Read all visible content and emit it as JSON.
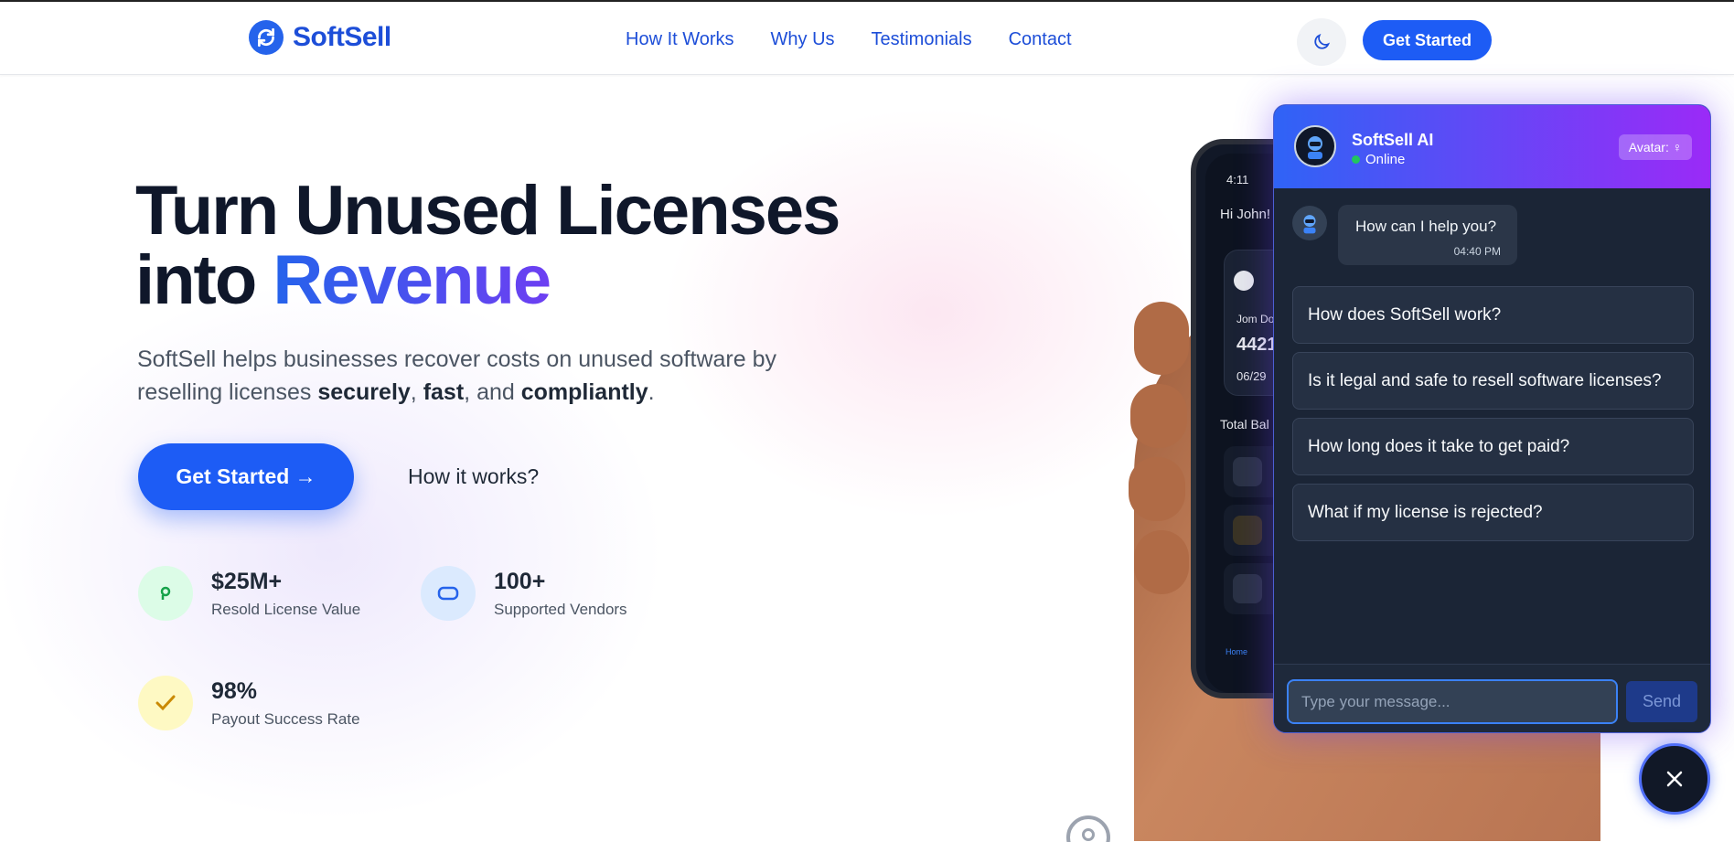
{
  "header": {
    "brand": "SoftSell",
    "nav": [
      "How It Works",
      "Why Us",
      "Testimonials",
      "Contact"
    ],
    "cta_label": "Get Started"
  },
  "hero": {
    "title_line1": "Turn Unused Licenses",
    "title_line2_prefix": "into ",
    "title_highlight": "Revenue",
    "subtitle_part1": "SoftSell helps businesses recover costs on unused software by reselling licenses ",
    "subtitle_bold1": "securely",
    "subtitle_sep1": ", ",
    "subtitle_bold2": "fast",
    "subtitle_sep2": ", and ",
    "subtitle_bold3": "compliantly",
    "subtitle_end": ".",
    "cta_label": "Get Started →",
    "secondary_label": "How it works?"
  },
  "stats": [
    {
      "value": "$25M+",
      "label": "Resold License Value",
      "icon": "coin-icon",
      "color": "#dcfce7"
    },
    {
      "value": "100+",
      "label": "Supported Vendors",
      "icon": "vendor-icon",
      "color": "#dbeafe"
    },
    {
      "value": "98%",
      "label": "Payout Success Rate",
      "icon": "check-icon",
      "color": "#fef9c3"
    }
  ],
  "phone": {
    "time": "4:11",
    "greeting": "Hi John!",
    "card_name": "Jom Do",
    "card_number": "4421",
    "card_expiry": "06/29",
    "balance_label": "Total Bal",
    "nav_home": "Home"
  },
  "chat": {
    "name": "SoftSell AI",
    "status": "Online",
    "avatar_toggle": "Avatar: ♀",
    "message": "How can I help you?",
    "message_time": "04:40 PM",
    "questions": [
      "How does SoftSell work?",
      "Is it legal and safe to resell software licenses?",
      "How long does it take to get paid?",
      "What if my license is rejected?"
    ],
    "input_placeholder": "Type your message...",
    "send_label": "Send"
  },
  "colors": {
    "brand": "#1d5cf5",
    "accent_gradient_end": "#9b2af7",
    "online": "#22c55e"
  }
}
